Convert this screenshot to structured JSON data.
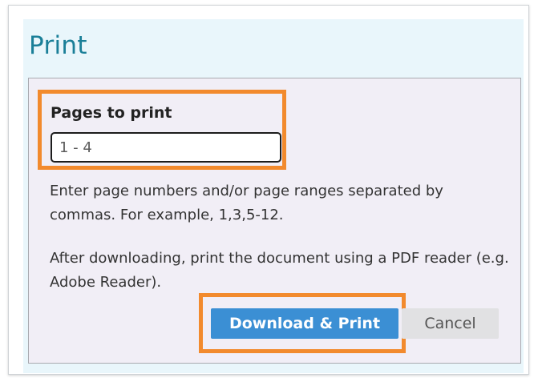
{
  "dialog": {
    "title": "Print"
  },
  "pages": {
    "label": "Pages to print",
    "value": "1 - 4"
  },
  "help": {
    "ranges": "Enter page numbers and/or page ranges separated by commas. For example, 1,3,5-12.",
    "download": "After downloading, print the document using a PDF reader (e.g. Adobe Reader)."
  },
  "actions": {
    "download_label": "Download & Print",
    "cancel_label": "Cancel"
  },
  "colors": {
    "title": "#1a7f98",
    "highlight": "#f28a2d",
    "primary_button": "#3b8fd4",
    "secondary_button": "#e1e1e3",
    "dialog_header_bg": "#e9f6fb",
    "content_bg": "#f1eef6"
  }
}
